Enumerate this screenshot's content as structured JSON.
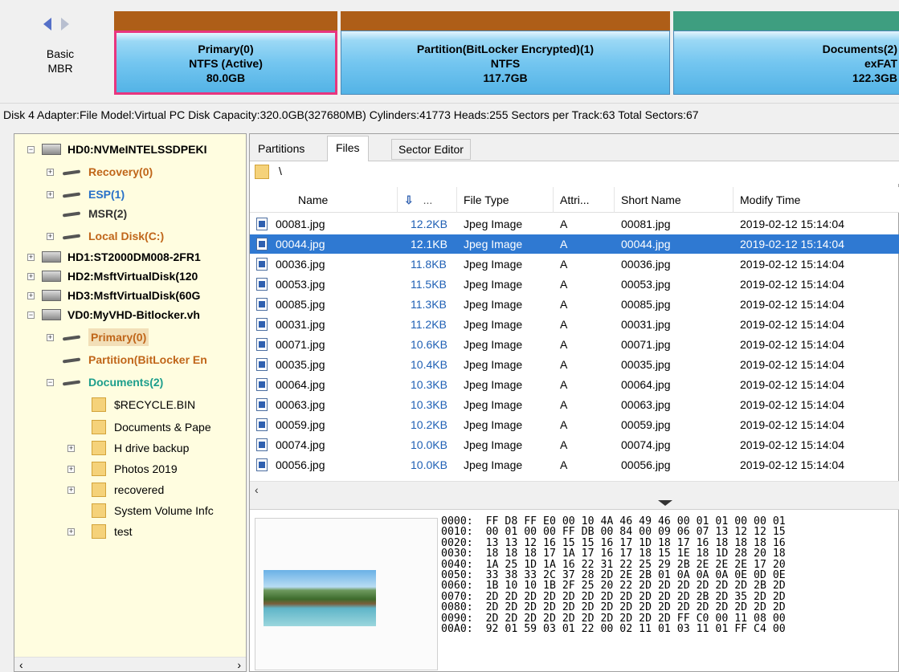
{
  "disk_map": {
    "basic_line1": "Basic",
    "basic_line2": "MBR",
    "partitions": [
      {
        "name": "Primary(0)",
        "fs": "NTFS (Active)",
        "size": "80.0GB"
      },
      {
        "name": "Partition(BitLocker Encrypted)(1)",
        "fs": "NTFS",
        "size": "117.7GB"
      },
      {
        "name": "Documents(2)",
        "fs": "exFAT",
        "size": "122.3GB"
      }
    ]
  },
  "disk_info": "Disk 4 Adapter:File  Model:Virtual PC Disk  Capacity:320.0GB(327680MB)  Cylinders:41773  Heads:255  Sectors per Track:63  Total Sectors:67",
  "tree": {
    "items": [
      {
        "label": "HD0:NVMeINTELSSDPEKI"
      },
      {
        "label": "Recovery(0)"
      },
      {
        "label": "ESP(1)"
      },
      {
        "label": "MSR(2)"
      },
      {
        "label": "Local Disk(C:)"
      },
      {
        "label": "HD1:ST2000DM008-2FR1"
      },
      {
        "label": "HD2:MsftVirtualDisk(120"
      },
      {
        "label": "HD3:MsftVirtualDisk(60G"
      },
      {
        "label": "VD0:MyVHD-Bitlocker.vh"
      },
      {
        "label": "Primary(0)"
      },
      {
        "label": "Partition(BitLocker En"
      },
      {
        "label": "Documents(2)"
      },
      {
        "label": "$RECYCLE.BIN"
      },
      {
        "label": "Documents & Pape"
      },
      {
        "label": "H drive backup"
      },
      {
        "label": "Photos 2019"
      },
      {
        "label": "recovered"
      },
      {
        "label": "System Volume Infc"
      },
      {
        "label": "test"
      }
    ]
  },
  "tabs": {
    "partitions": "Partitions",
    "files": "Files",
    "sector_editor": "Sector Editor"
  },
  "path": "\\",
  "columns": {
    "name": "Name",
    "size": "...",
    "type": "File Type",
    "attr": "Attri...",
    "short": "Short Name",
    "time": "Modify Time"
  },
  "files": [
    {
      "name": "00081.jpg",
      "size": "12.2KB",
      "type": "Jpeg Image",
      "attr": "A",
      "short": "00081.jpg",
      "time": "2019-02-12 15:14:04"
    },
    {
      "name": "00044.jpg",
      "size": "12.1KB",
      "type": "Jpeg Image",
      "attr": "A",
      "short": "00044.jpg",
      "time": "2019-02-12 15:14:04"
    },
    {
      "name": "00036.jpg",
      "size": "11.8KB",
      "type": "Jpeg Image",
      "attr": "A",
      "short": "00036.jpg",
      "time": "2019-02-12 15:14:04"
    },
    {
      "name": "00053.jpg",
      "size": "11.5KB",
      "type": "Jpeg Image",
      "attr": "A",
      "short": "00053.jpg",
      "time": "2019-02-12 15:14:04"
    },
    {
      "name": "00085.jpg",
      "size": "11.3KB",
      "type": "Jpeg Image",
      "attr": "A",
      "short": "00085.jpg",
      "time": "2019-02-12 15:14:04"
    },
    {
      "name": "00031.jpg",
      "size": "11.2KB",
      "type": "Jpeg Image",
      "attr": "A",
      "short": "00031.jpg",
      "time": "2019-02-12 15:14:04"
    },
    {
      "name": "00071.jpg",
      "size": "10.6KB",
      "type": "Jpeg Image",
      "attr": "A",
      "short": "00071.jpg",
      "time": "2019-02-12 15:14:04"
    },
    {
      "name": "00035.jpg",
      "size": "10.4KB",
      "type": "Jpeg Image",
      "attr": "A",
      "short": "00035.jpg",
      "time": "2019-02-12 15:14:04"
    },
    {
      "name": "00064.jpg",
      "size": "10.3KB",
      "type": "Jpeg Image",
      "attr": "A",
      "short": "00064.jpg",
      "time": "2019-02-12 15:14:04"
    },
    {
      "name": "00063.jpg",
      "size": "10.3KB",
      "type": "Jpeg Image",
      "attr": "A",
      "short": "00063.jpg",
      "time": "2019-02-12 15:14:04"
    },
    {
      "name": "00059.jpg",
      "size": "10.2KB",
      "type": "Jpeg Image",
      "attr": "A",
      "short": "00059.jpg",
      "time": "2019-02-12 15:14:04"
    },
    {
      "name": "00074.jpg",
      "size": "10.0KB",
      "type": "Jpeg Image",
      "attr": "A",
      "short": "00074.jpg",
      "time": "2019-02-12 15:14:04"
    },
    {
      "name": "00056.jpg",
      "size": "10.0KB",
      "type": "Jpeg Image",
      "attr": "A",
      "short": "00056.jpg",
      "time": "2019-02-12 15:14:04"
    }
  ],
  "hex_lines": [
    "0000:  FF D8 FF E0 00 10 4A 46 49 46 00 01 01 00 00 01",
    "0010:  00 01 00 00 FF DB 00 84 00 09 06 07 13 12 12 15",
    "0020:  13 13 12 16 15 15 16 17 1D 18 17 16 18 18 18 16",
    "0030:  18 18 18 17 1A 17 16 17 18 15 1E 18 1D 28 20 18",
    "0040:  1A 25 1D 1A 16 22 31 22 25 29 2B 2E 2E 2E 17 20",
    "0050:  33 38 33 2C 37 28 2D 2E 2B 01 0A 0A 0A 0E 0D 0E",
    "0060:  1B 10 10 1B 2F 25 20 22 2D 2D 2D 2D 2D 2D 2B 2D",
    "0070:  2D 2D 2D 2D 2D 2D 2D 2D 2D 2D 2D 2B 2D 35 2D 2D",
    "0080:  2D 2D 2D 2D 2D 2D 2D 2D 2D 2D 2D 2D 2D 2D 2D 2D",
    "0090:  2D 2D 2D 2D 2D 2D 2D 2D 2D 2D FF C0 00 11 08 00",
    "00A0:  92 01 59 03 01 22 00 02 11 01 03 11 01 FF C4 00"
  ]
}
